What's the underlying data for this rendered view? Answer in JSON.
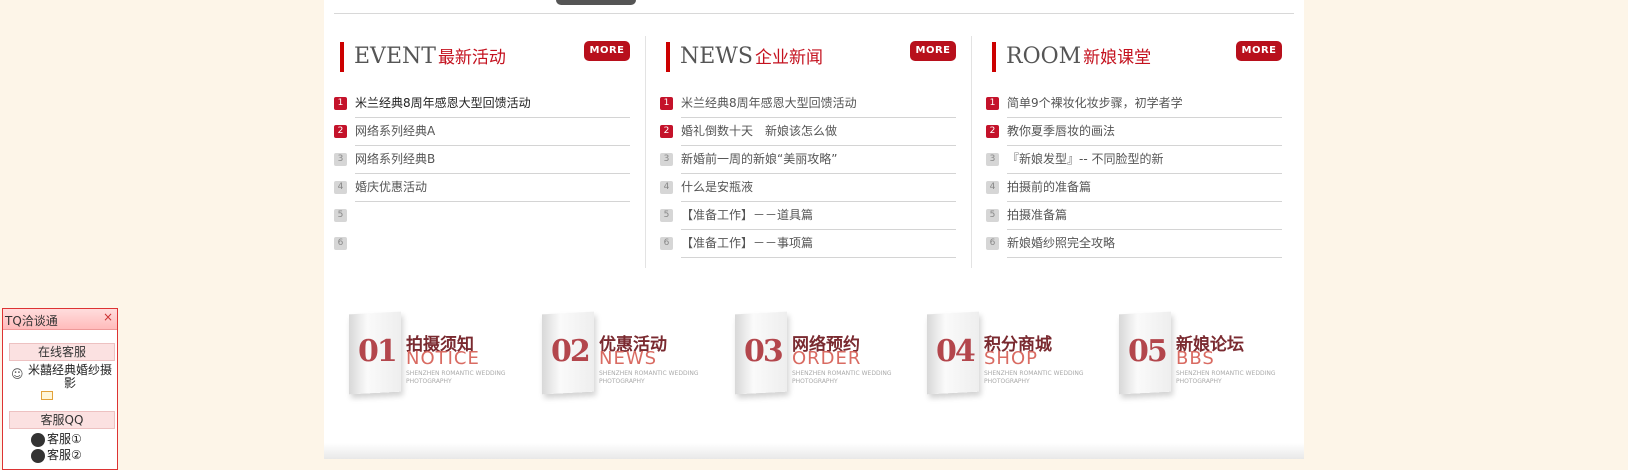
{
  "sections": [
    {
      "title_en": "EVENT",
      "title_cn": "最新活动",
      "more_label": "MORE",
      "items": [
        {
          "num": "1",
          "text": "米兰经典8周年感恩大型回馈活动"
        },
        {
          "num": "2",
          "text": "网络系列经典A"
        },
        {
          "num": "3",
          "text": "网络系列经典B"
        },
        {
          "num": "4",
          "text": "婚庆优惠活动"
        },
        {
          "num": "5",
          "text": ""
        },
        {
          "num": "6",
          "text": ""
        }
      ]
    },
    {
      "title_en": "NEWS",
      "title_cn": "企业新闻",
      "more_label": "MORE",
      "items": [
        {
          "num": "1",
          "text": "米兰经典8周年感恩大型回馈活动"
        },
        {
          "num": "2",
          "text": "婚礼倒数十天　新娘该怎么做"
        },
        {
          "num": "3",
          "text": "新婚前一周的新娘“美丽攻略”"
        },
        {
          "num": "4",
          "text": "什么是安瓶液"
        },
        {
          "num": "5",
          "text": "【准备工作】－－道具篇"
        },
        {
          "num": "6",
          "text": "【准备工作】－－事项篇"
        }
      ]
    },
    {
      "title_en": "ROOM",
      "title_cn": "新娘课堂",
      "more_label": "MORE",
      "items": [
        {
          "num": "1",
          "text": "简单9个裸妆化妆步骤，初学者学"
        },
        {
          "num": "2",
          "text": "教你夏季唇妆的画法"
        },
        {
          "num": "3",
          "text": "『新娘发型』-- 不同脸型的新"
        },
        {
          "num": "4",
          "text": "拍摄前的准备篇"
        },
        {
          "num": "5",
          "text": "拍摄准备篇"
        },
        {
          "num": "6",
          "text": "新娘婚纱照完全攻略"
        }
      ]
    }
  ],
  "banners": [
    {
      "num": "01",
      "cn": "拍摄须知",
      "en": "NOTICE",
      "sub": "SHENZHEN ROMANTIC WEDDING PHOTOGRAPHY"
    },
    {
      "num": "02",
      "cn": "优惠活动",
      "en": "NEWS",
      "sub": "SHENZHEN ROMANTIC WEDDING PHOTOGRAPHY"
    },
    {
      "num": "03",
      "cn": "网络预约",
      "en": "ORDER",
      "sub": "SHENZHEN ROMANTIC WEDDING PHOTOGRAPHY"
    },
    {
      "num": "04",
      "cn": "积分商城",
      "en": "SHOP",
      "sub": "SHENZHEN ROMANTIC WEDDING PHOTOGRAPHY"
    },
    {
      "num": "05",
      "cn": "新娘论坛",
      "en": "BBS",
      "sub": "SHENZHEN ROMANTIC WEDDING PHOTOGRAPHY"
    }
  ],
  "tq": {
    "title": "TQ洽谈通",
    "close": "×",
    "online_label": "在线客服",
    "company": "米囍经典婚纱摄影",
    "qq_label": "客服QQ",
    "qq_items": [
      "客服①",
      "客服②"
    ]
  },
  "colors": {
    "accent": "#c4121f",
    "more_bg": "#b8101c",
    "background": "#fdf5e8"
  }
}
